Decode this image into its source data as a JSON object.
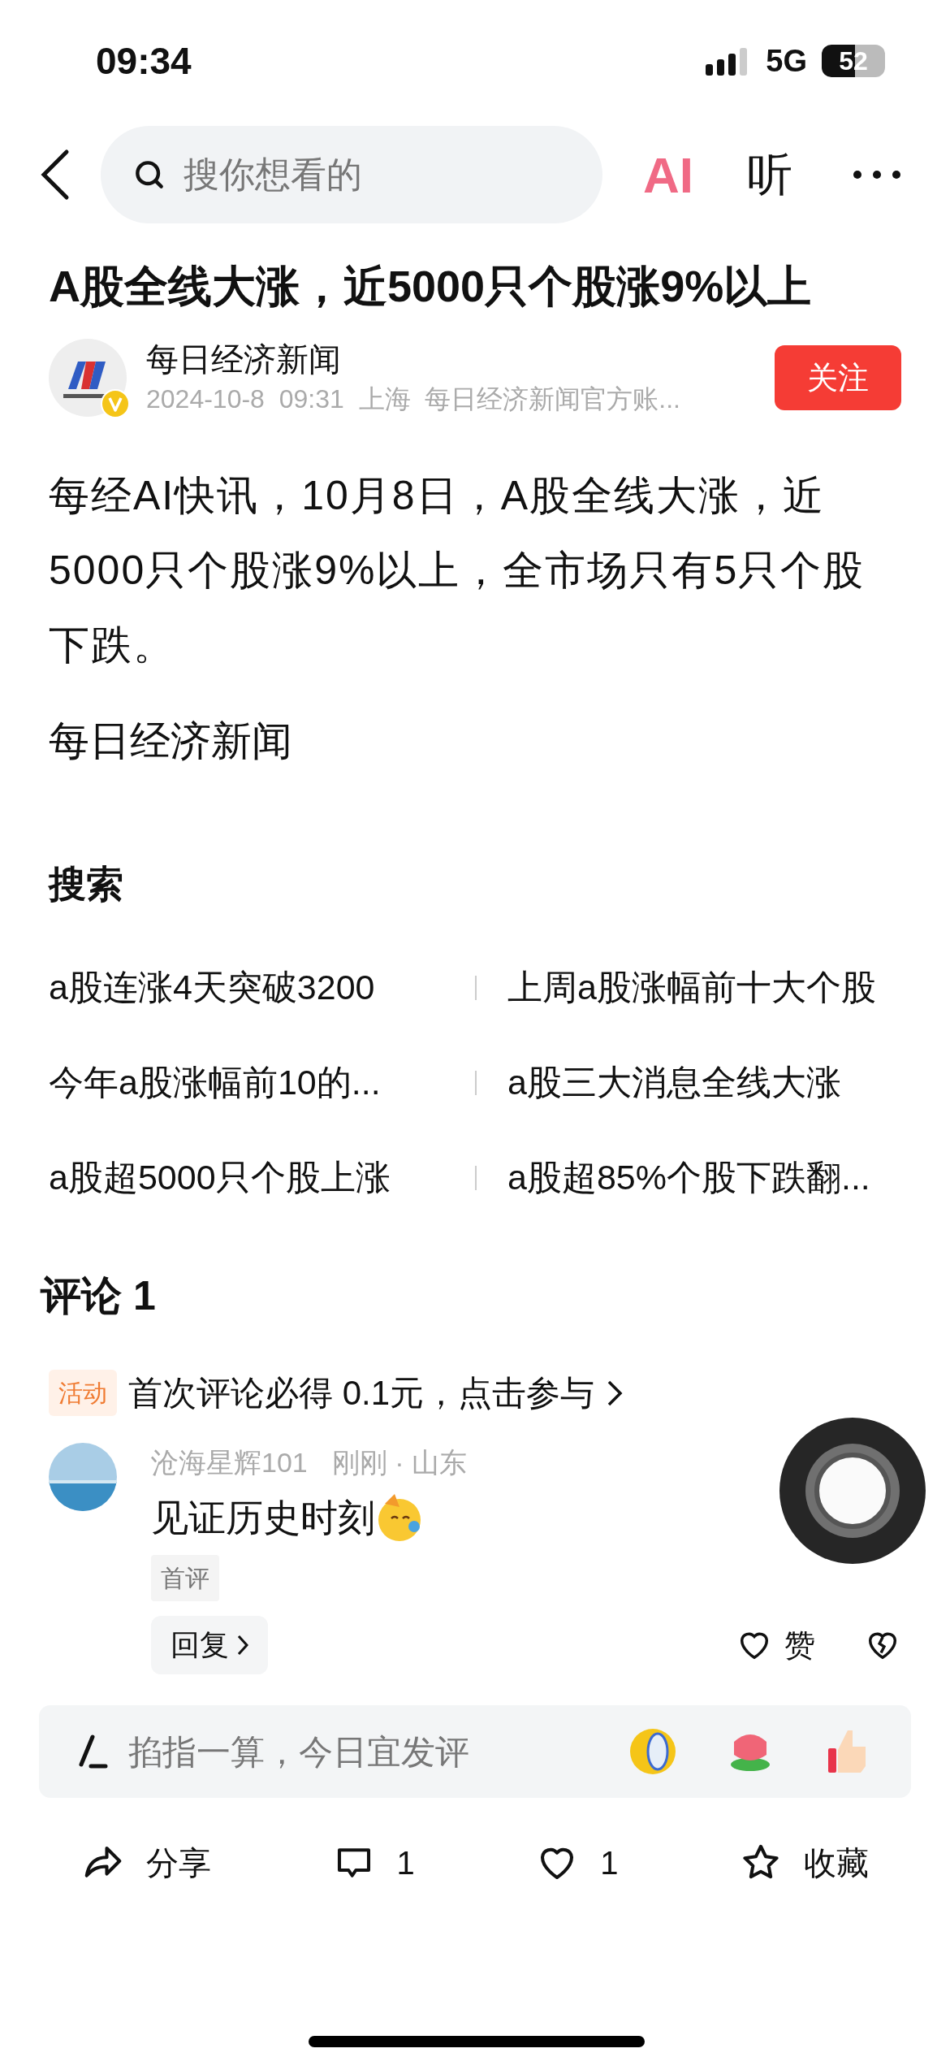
{
  "status_bar": {
    "time": "09:34",
    "network": "5G",
    "battery": "52"
  },
  "nav": {
    "search_placeholder": "搜你想看的",
    "ai": "AI",
    "listen": "听"
  },
  "article": {
    "title": "A股全线大涨，近5000只个股涨9%以上",
    "author": {
      "name": "每日经济新闻",
      "verified": true,
      "meta": "2024-10-8  09:31  上海  每日经济新闻官方账...",
      "follow": {
        "label": "关注",
        "followed": false
      }
    },
    "paragraphs": [
      "每经AI快讯，10月8日，A股全线大涨，近5000只个股涨9%以上，全市场只有5只个股下跌。",
      "每日经济新闻"
    ]
  },
  "search": {
    "heading": "搜索",
    "items": [
      "a股连涨4天突破3200",
      "上周a股涨幅前十大个股",
      "今年a股涨幅前10的...",
      "a股三大消息全线大涨",
      "a股超5000只个股上涨",
      "a股超85%个股下跌翻..."
    ]
  },
  "comments": {
    "heading": "评论 1",
    "promo": {
      "tag": "活动",
      "text": "首次评论必得 0.1元，点击参与"
    },
    "items": [
      {
        "user": "沧海星辉101",
        "meta": "刚刚 · 山东",
        "text": "见证历史时刻",
        "tag": "首评",
        "reply": "回复",
        "like": "赞",
        "liked": false
      }
    ]
  },
  "composer": {
    "placeholder": "掐指一算，今日宜发评"
  },
  "actions": [
    {
      "kind": "share",
      "label": "分享"
    },
    {
      "kind": "comment",
      "label": "1"
    },
    {
      "kind": "like",
      "label": "1"
    },
    {
      "kind": "favorite",
      "label": "收藏"
    }
  ]
}
